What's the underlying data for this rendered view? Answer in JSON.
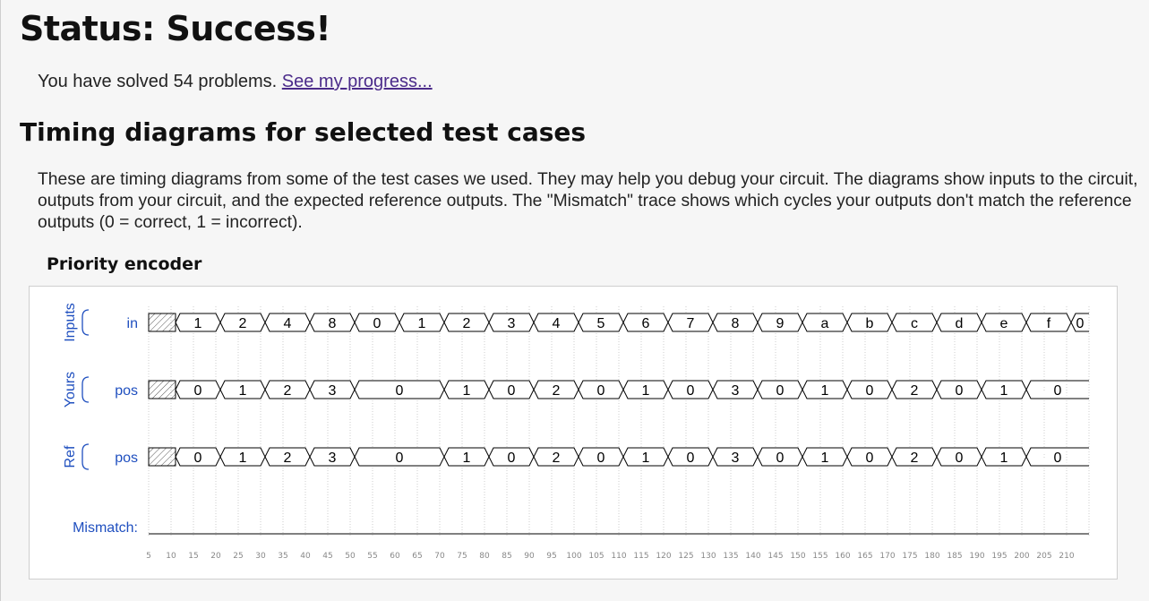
{
  "status": {
    "title": "Status: Success!"
  },
  "progress": {
    "text": "You have solved 54 problems. ",
    "link_label": "See my progress..."
  },
  "section": {
    "heading": "Timing diagrams for selected test cases",
    "description": "These are timing diagrams from some of the test cases we used. They may help you debug your circuit. The diagrams show inputs to the circuit, outputs from your circuit, and the expected reference outputs. The \"Mismatch\" trace shows which cycles your outputs don't match the reference outputs (0 = correct, 1 = incorrect)."
  },
  "diagram": {
    "title": "Priority encoder",
    "groups": [
      {
        "label": "Inputs",
        "signals": [
          0
        ]
      },
      {
        "label": "Yours",
        "signals": [
          1
        ]
      },
      {
        "label": "Ref",
        "signals": [
          2
        ]
      }
    ],
    "signals": [
      {
        "name": "in",
        "values": [
          "1",
          "2",
          "4",
          "8",
          "0",
          "1",
          "2",
          "3",
          "4",
          "5",
          "6",
          "7",
          "8",
          "9",
          "a",
          "b",
          "c",
          "d",
          "e",
          "f",
          "0"
        ]
      },
      {
        "name": "pos",
        "values": [
          "0",
          "1",
          "2",
          "3",
          "0",
          "0",
          "1",
          "0",
          "2",
          "0",
          "1",
          "0",
          "3",
          "0",
          "1",
          "0",
          "2",
          "0",
          "1",
          "0",
          "0"
        ]
      },
      {
        "name": "pos",
        "values": [
          "0",
          "1",
          "2",
          "3",
          "0",
          "0",
          "1",
          "0",
          "2",
          "0",
          "1",
          "0",
          "3",
          "0",
          "1",
          "0",
          "2",
          "0",
          "1",
          "0",
          "0"
        ]
      }
    ],
    "mismatch_label": "Mismatch:",
    "mismatch_values": [
      0,
      0,
      0,
      0,
      0,
      0,
      0,
      0,
      0,
      0,
      0,
      0,
      0,
      0,
      0,
      0,
      0,
      0,
      0,
      0,
      0
    ],
    "time_ticks": [
      "5",
      "10",
      "15",
      "20",
      "25",
      "30",
      "35",
      "40",
      "45",
      "50",
      "55",
      "60",
      "65",
      "70",
      "75",
      "80",
      "85",
      "90",
      "95",
      "100",
      "105",
      "110",
      "115",
      "120",
      "125",
      "130",
      "135",
      "140",
      "145",
      "150",
      "155",
      "160",
      "165",
      "170",
      "175",
      "180",
      "185",
      "190",
      "195",
      "200",
      "205",
      "210"
    ],
    "colors": {
      "label_blue": "#1f4fbf",
      "axis_gray": "#888888",
      "trace": "#000000",
      "grid": "#cccccc"
    }
  }
}
